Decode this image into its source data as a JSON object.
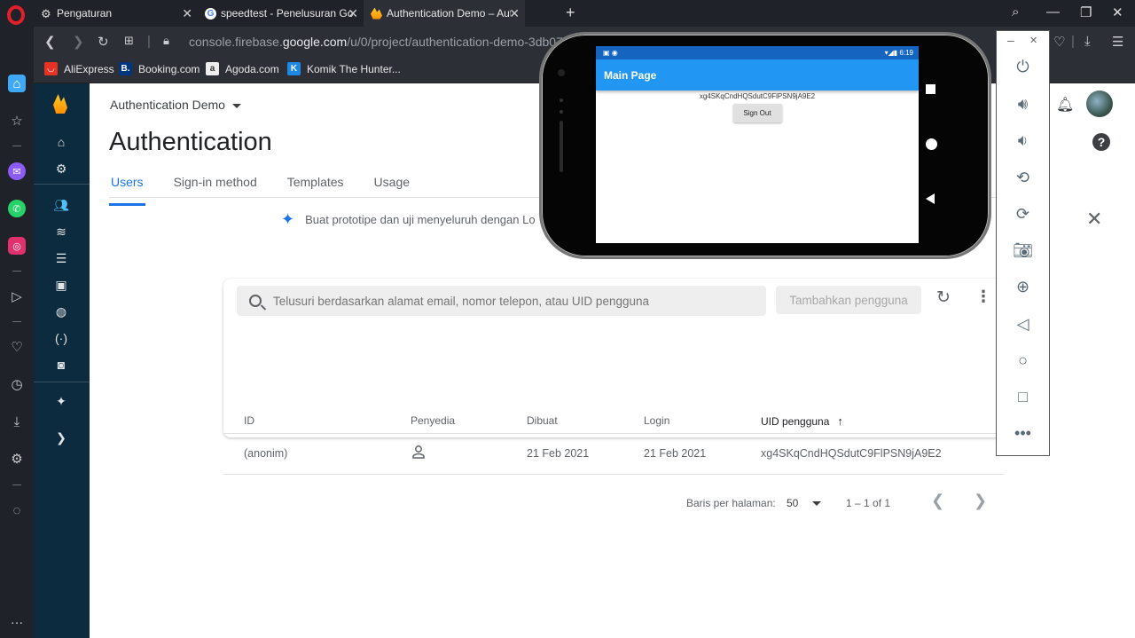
{
  "browser": {
    "tabs": [
      {
        "title": "Pengaturan"
      },
      {
        "title": "speedtest - Penelusuran Go"
      },
      {
        "title": "Authentication Demo – Aut"
      }
    ],
    "url_pre": "console.firebase.",
    "url_domain": "google.com",
    "url_post": "/u/0/project/authentication-demo-3db07/",
    "bookmarks": [
      {
        "label": "AliExpress",
        "color": "#e43225"
      },
      {
        "label": "Booking.com",
        "color": "#003580"
      },
      {
        "label": "Agoda.com",
        "color": "#eeeeee"
      },
      {
        "label": "Komik The Hunter...",
        "color": "#1e88e5"
      }
    ]
  },
  "firebase": {
    "project": "Authentication Demo",
    "title": "Authentication",
    "tabs": [
      "Users",
      "Sign-in method",
      "Templates",
      "Usage"
    ],
    "promo": "Buat prototipe dan uji menyeluruh dengan Lo",
    "search_placeholder": "Telusuri berdasarkan alamat email, nomor telepon, atau UID pengguna",
    "add_user": "Tambahkan pengguna",
    "columns": [
      "ID",
      "Penyedia",
      "Dibuat",
      "Login",
      "UID pengguna"
    ],
    "rows": [
      {
        "id": "(anonim)",
        "created": "21 Feb 2021",
        "login": "21 Feb 2021",
        "uid": "xg4SKqCndHQSdutC9FlPSN9jA9E2"
      }
    ],
    "rows_per_page_label": "Baris per halaman:",
    "rows_per_page": "50",
    "range": "1 – 1 of 1"
  },
  "emulator": {
    "time": "6:19",
    "app_title": "Main Page",
    "uid": "xg4SKqCndHQSdutC9FlPSN9jA9E2",
    "sign_out": "Sign Out"
  },
  "colors": {
    "accent": "#1a73e8",
    "app_bar": "#2196f3",
    "firebase_sidebar": "#0d2b3e"
  }
}
